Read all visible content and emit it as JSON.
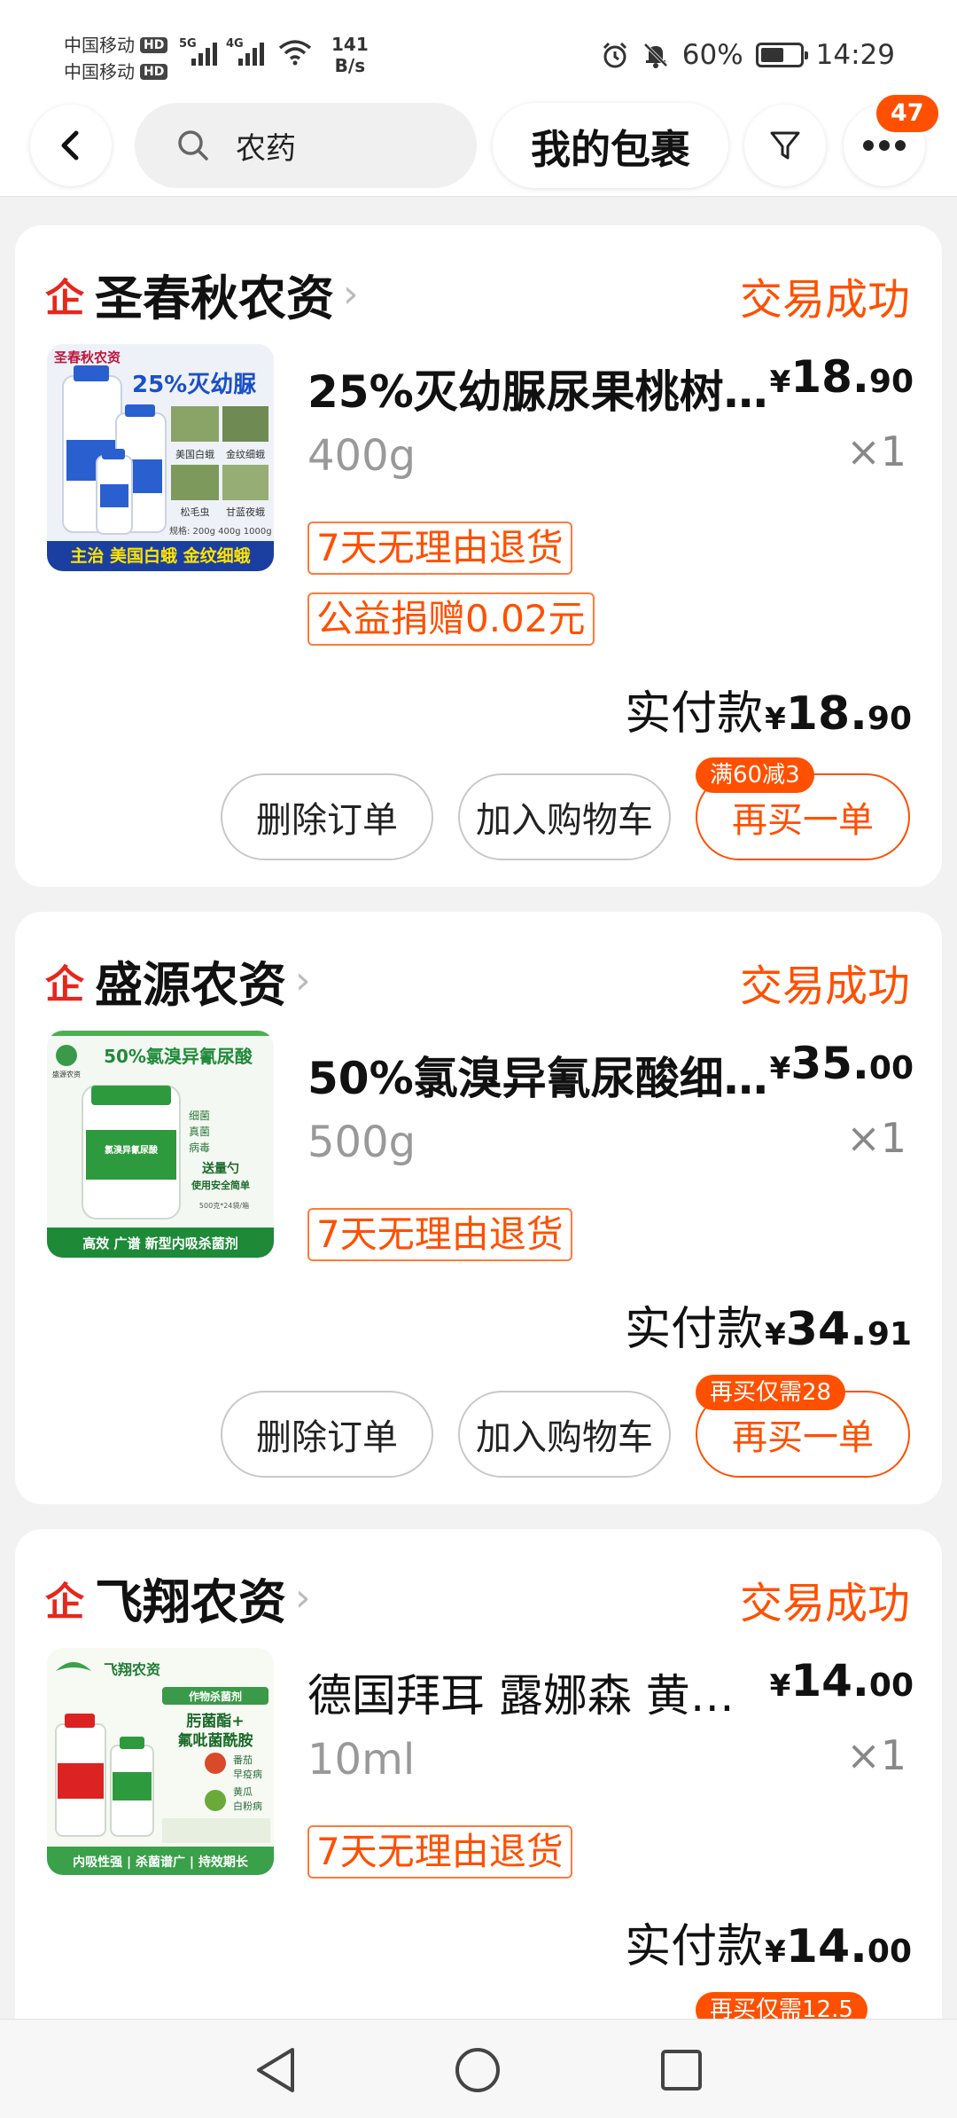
{
  "status_bar": {
    "carrier_1": "中国移动",
    "carrier_2": "中国移动",
    "hd_label": "HD",
    "net_1": "5G",
    "net_2": "4G",
    "speed_value": "141",
    "speed_unit": "B/s",
    "battery": "60%",
    "battery_level": 0.6,
    "time": "14:29"
  },
  "top_nav": {
    "search_query": "农药",
    "my_packages": "我的包裹",
    "notification_count": "47"
  },
  "orders": [
    {
      "qi_glyph": "企",
      "shop": "圣春秋农资",
      "status": "交易成功",
      "product_name": "25%灭幼脲尿果桃树…",
      "price_currency": "¥",
      "price_int": "18.",
      "price_dec": "90",
      "spec": "400g",
      "quantity": "×1",
      "tags": [
        "7天无理由退货",
        "公益捐赠0.02元"
      ],
      "paid_label": "实付款",
      "paid_currency": "¥",
      "paid_int": "18.",
      "paid_dec": "90",
      "btn_delete": "删除订单",
      "btn_cart": "加入购物车",
      "btn_rebuy": "再买一单",
      "promo": "满60减3",
      "thumb": {
        "brand": "圣春秋农资",
        "title": "25%灭幼脲",
        "caption": "主治 美国白蛾 金纹细蛾",
        "spec_line": "规格: 200g 400g 1000g",
        "labels": [
          "美国白蛾",
          "金纹细蛾",
          "松毛虫",
          "甘蓝夜蛾"
        ]
      }
    },
    {
      "qi_glyph": "企",
      "shop": "盛源农资",
      "status": "交易成功",
      "product_name": "50%氯溴异氰尿酸细…",
      "price_currency": "¥",
      "price_int": "35.",
      "price_dec": "00",
      "spec": "500g",
      "quantity": "×1",
      "tags": [
        "7天无理由退货"
      ],
      "paid_label": "实付款",
      "paid_currency": "¥",
      "paid_int": "34.",
      "paid_dec": "91",
      "btn_delete": "删除订单",
      "btn_cart": "加入购物车",
      "btn_rebuy": "再买一单",
      "promo": "再买仅需28",
      "thumb": {
        "brand": "盛源农资",
        "title": "50%氯溴异氰尿酸",
        "bullets": [
          "细菌",
          "真菌",
          "病毒"
        ],
        "highlight_1": "送量勺",
        "highlight_2": "使用安全简单",
        "bottle_label": "氯溴异氰尿酸",
        "spec_line": "500克*24袋/箱",
        "caption": "高效 广谱 新型内吸杀菌剂"
      }
    },
    {
      "qi_glyph": "企",
      "shop": "飞翔农资",
      "status": "交易成功",
      "product_name": "德国拜耳 露娜森 黄…",
      "price_currency": "¥",
      "price_int": "14.",
      "price_dec": "00",
      "spec": "10ml",
      "quantity": "×1",
      "tags": [
        "7天无理由退货"
      ],
      "paid_label": "实付款",
      "paid_currency": "¥",
      "paid_int": "14.",
      "paid_dec": "00",
      "promo": "再买仅需12.5",
      "thumb": {
        "brand": "飞翔农资",
        "tag": "作物杀菌剂",
        "title_1": "肟菌酯+",
        "title_2": "氟吡菌酰胺",
        "labels": [
          "番茄",
          "早疫病",
          "黄瓜",
          "白粉病"
        ],
        "caption": "内吸性强 | 杀菌谱广 | 持效期长"
      }
    }
  ]
}
